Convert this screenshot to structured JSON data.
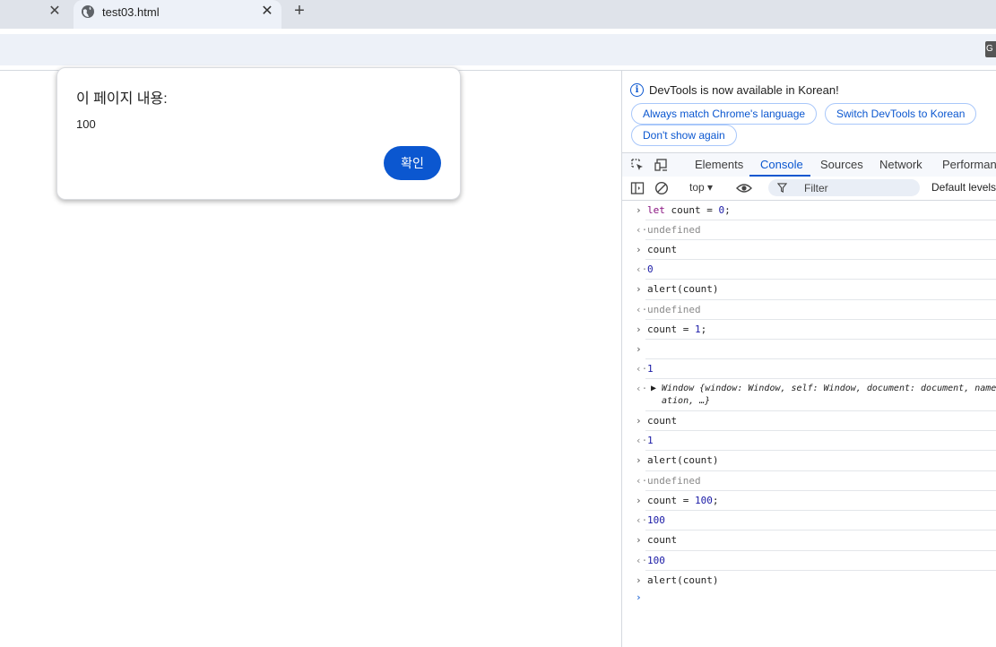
{
  "browser": {
    "tab_title": "test03.html",
    "close_glyph": "✕",
    "new_tab_glyph": "+",
    "translate_glyph": "G"
  },
  "dialog": {
    "title": "이 페이지 내용:",
    "message": "100",
    "ok_label": "확인"
  },
  "devtools": {
    "info_glyph": "i",
    "banner_text": "DevTools is now available in Korean!",
    "banner_buttons": [
      "Always match Chrome's language",
      "Switch DevTools to Korean",
      "Don't show again"
    ],
    "tabs": [
      "Elements",
      "Console",
      "Sources",
      "Network",
      "Performanc"
    ],
    "active_tab": "Console",
    "context": "top ▾",
    "filter_placeholder": "Filter",
    "levels_label": "Default levels",
    "console_rows": [
      {
        "arrow": "›",
        "text": "let count = 0;"
      },
      {
        "arrow": "‹·",
        "text": "undefined"
      },
      {
        "arrow": "›",
        "text": "count"
      },
      {
        "arrow": "‹·",
        "text": "0"
      },
      {
        "arrow": "›",
        "text": "alert(count)"
      },
      {
        "arrow": "‹·",
        "text": "undefined"
      },
      {
        "arrow": "›",
        "text": "count = 1;"
      },
      {
        "arrow": "›",
        "text": ""
      },
      {
        "arrow": "‹·",
        "text": "1"
      },
      {
        "arrow": "‹·",
        "text": "▶ Window {window: Window, self: Window, document: document, name",
        "text2": "ation, …}"
      },
      {
        "arrow": "›",
        "text": "count"
      },
      {
        "arrow": "‹·",
        "text": "1"
      },
      {
        "arrow": "›",
        "text": "alert(count)"
      },
      {
        "arrow": "‹·",
        "text": "undefined"
      },
      {
        "arrow": "›",
        "text": "count = 100;"
      },
      {
        "arrow": "‹·",
        "text": "100"
      },
      {
        "arrow": "›",
        "text": "count"
      },
      {
        "arrow": "‹·",
        "text": "100"
      },
      {
        "arrow": "›",
        "text": "alert(count)"
      }
    ],
    "prompt_glyph": "›"
  }
}
